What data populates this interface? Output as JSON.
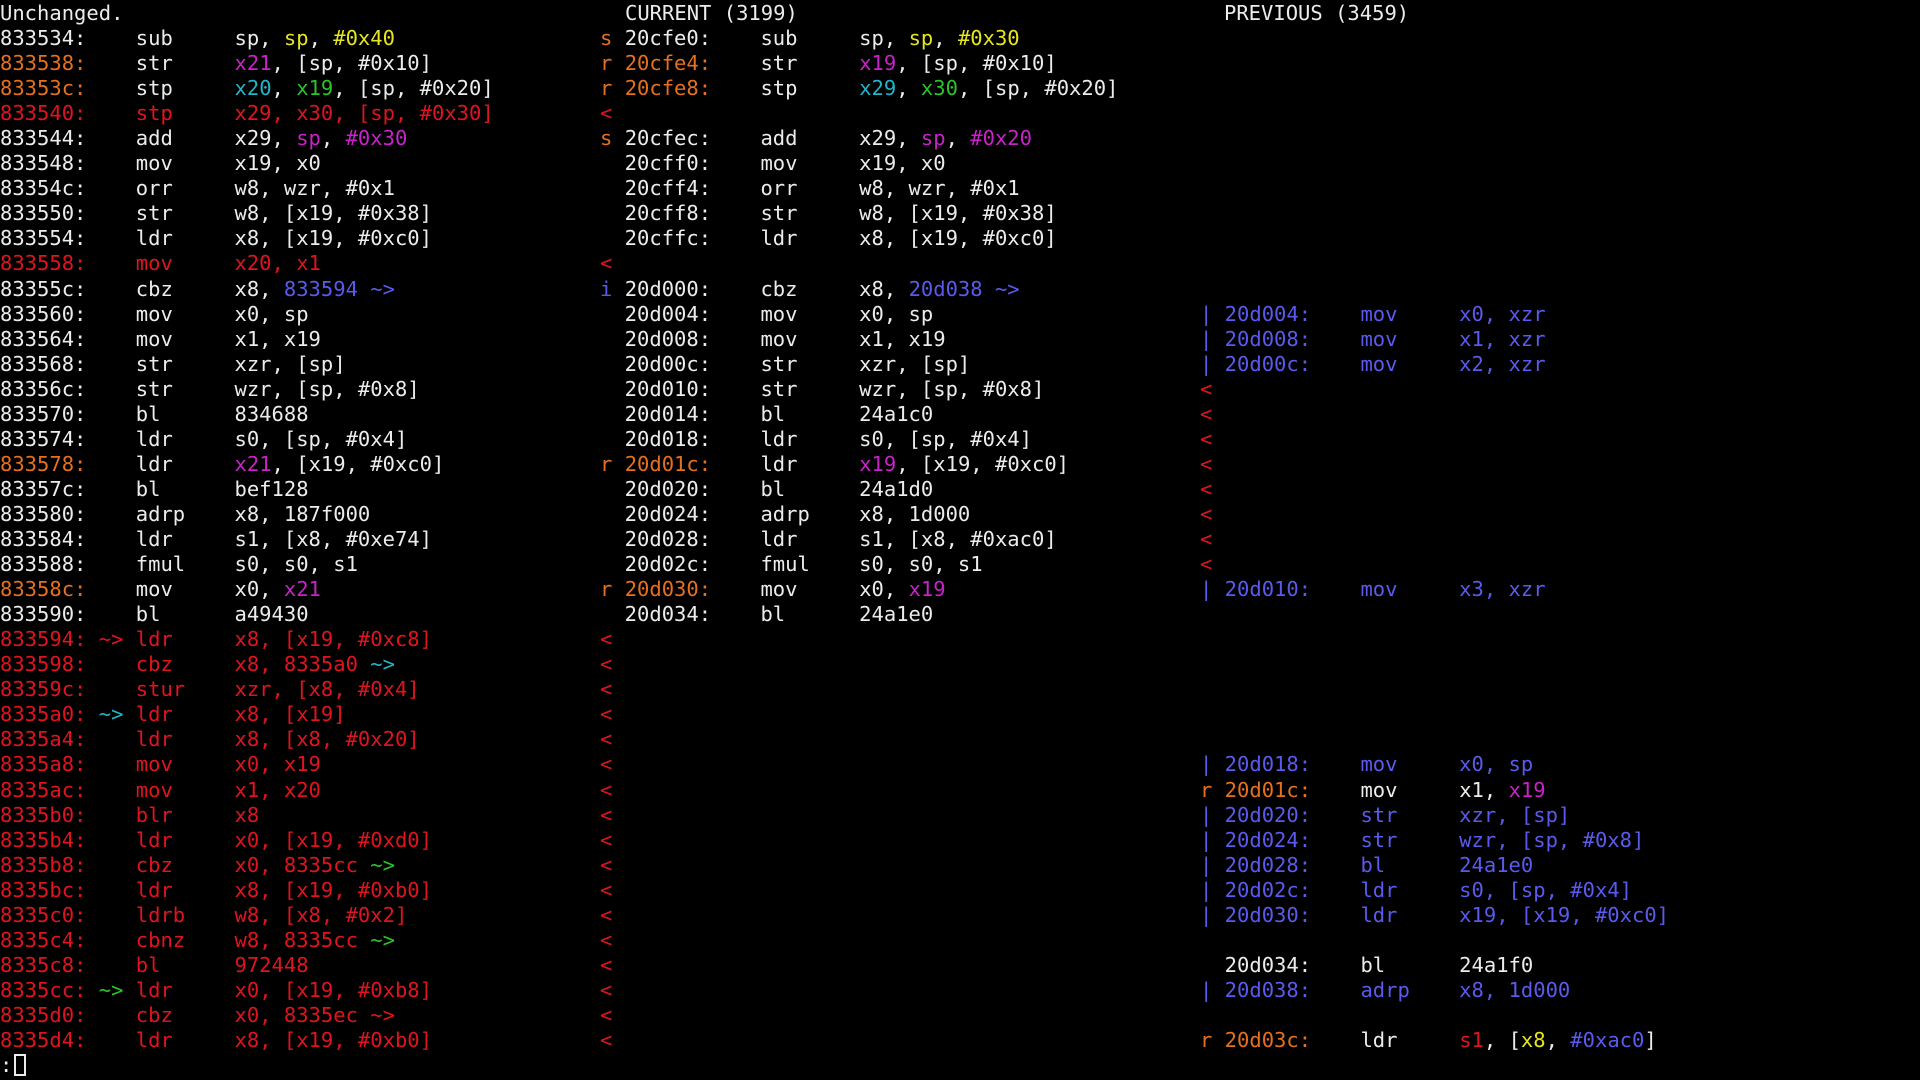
{
  "colors": {
    "default": "#ececec",
    "removed": "#e0141e",
    "changed": "#e6701e",
    "magenta": "#c823c8",
    "green": "#2bc42b",
    "cyan": "#20b6c8",
    "yellow": "#e6e61e",
    "blue": "#5a5aee"
  },
  "header": {
    "left_title": "Unchanged.",
    "current_title": "CURRENT (3199)",
    "previous_title": "PREVIOUS (3459)"
  },
  "prompt": ":",
  "rows": [
    [
      [
        [
          "default",
          "833534:    sub     sp, "
        ],
        [
          "yellow",
          "sp"
        ],
        [
          "default",
          ", "
        ],
        [
          "yellow",
          "#0x40"
        ]
      ],
      [
        [
          "changed",
          "s "
        ],
        [
          "default",
          "20cfe0:    sub     sp, "
        ],
        [
          "yellow",
          "sp"
        ],
        [
          "default",
          ", "
        ],
        [
          "yellow",
          "#0x30"
        ]
      ],
      []
    ],
    [
      [
        [
          "changed",
          "833538:    "
        ],
        [
          "default",
          "str     "
        ],
        [
          "magenta",
          "x21"
        ],
        [
          "default",
          ", [sp, #0x10]"
        ]
      ],
      [
        [
          "changed",
          "r "
        ],
        [
          "changed",
          "20cfe4:    "
        ],
        [
          "default",
          "str     "
        ],
        [
          "magenta",
          "x19"
        ],
        [
          "default",
          ", [sp, #0x10]"
        ]
      ],
      []
    ],
    [
      [
        [
          "changed",
          "83353c:    "
        ],
        [
          "default",
          "stp     "
        ],
        [
          "cyan",
          "x20"
        ],
        [
          "default",
          ", "
        ],
        [
          "green",
          "x19"
        ],
        [
          "default",
          ", [sp, #0x20]"
        ]
      ],
      [
        [
          "changed",
          "r "
        ],
        [
          "changed",
          "20cfe8:    "
        ],
        [
          "default",
          "stp     "
        ],
        [
          "cyan",
          "x29"
        ],
        [
          "default",
          ", "
        ],
        [
          "green",
          "x30"
        ],
        [
          "default",
          ", [sp, #0x20]"
        ]
      ],
      []
    ],
    [
      [
        [
          "removed",
          "833540:    stp     x29, x30, [sp, #0x30]"
        ]
      ],
      [
        [
          "removed",
          "<"
        ]
      ],
      []
    ],
    [
      [
        [
          "default",
          "833544:    add     x29, "
        ],
        [
          "magenta",
          "sp"
        ],
        [
          "default",
          ", "
        ],
        [
          "magenta",
          "#0x30"
        ]
      ],
      [
        [
          "changed",
          "s "
        ],
        [
          "default",
          "20cfec:    add     x29, "
        ],
        [
          "magenta",
          "sp"
        ],
        [
          "default",
          ", "
        ],
        [
          "magenta",
          "#0x20"
        ]
      ],
      []
    ],
    [
      [
        [
          "default",
          "833548:    mov     x19, x0"
        ]
      ],
      [
        [
          "default",
          "  20cff0:    mov     x19, x0"
        ]
      ],
      []
    ],
    [
      [
        [
          "default",
          "83354c:    orr     w8, wzr, #0x1"
        ]
      ],
      [
        [
          "default",
          "  20cff4:    orr     w8, wzr, #0x1"
        ]
      ],
      []
    ],
    [
      [
        [
          "default",
          "833550:    str     w8, [x19, #0x38]"
        ]
      ],
      [
        [
          "default",
          "  20cff8:    str     w8, [x19, #0x38]"
        ]
      ],
      []
    ],
    [
      [
        [
          "default",
          "833554:    ldr     x8, [x19, #0xc0]"
        ]
      ],
      [
        [
          "default",
          "  20cffc:    ldr     x8, [x19, #0xc0]"
        ]
      ],
      []
    ],
    [
      [
        [
          "removed",
          "833558:    mov     x20, x1"
        ]
      ],
      [
        [
          "removed",
          "<"
        ]
      ],
      []
    ],
    [
      [
        [
          "default",
          "83355c:    cbz     x8, "
        ],
        [
          "blue",
          "833594 ~>"
        ]
      ],
      [
        [
          "blue",
          "i "
        ],
        [
          "default",
          "20d000:    cbz     x8, "
        ],
        [
          "blue",
          "20d038 ~>"
        ]
      ],
      []
    ],
    [
      [
        [
          "default",
          "833560:    mov     x0, sp"
        ]
      ],
      [
        [
          "default",
          "  20d004:    mov     x0, sp"
        ]
      ],
      [
        [
          "blue",
          "| 20d004:    mov     x0, xzr"
        ]
      ]
    ],
    [
      [
        [
          "default",
          "833564:    mov     x1, x19"
        ]
      ],
      [
        [
          "default",
          "  20d008:    mov     x1, x19"
        ]
      ],
      [
        [
          "blue",
          "| 20d008:    mov     x1, xzr"
        ]
      ]
    ],
    [
      [
        [
          "default",
          "833568:    str     xzr, [sp]"
        ]
      ],
      [
        [
          "default",
          "  20d00c:    str     xzr, [sp]"
        ]
      ],
      [
        [
          "blue",
          "| 20d00c:    mov     x2, xzr"
        ]
      ]
    ],
    [
      [
        [
          "default",
          "83356c:    str     wzr, [sp, #0x8]"
        ]
      ],
      [
        [
          "default",
          "  20d010:    str     wzr, [sp, #0x8]"
        ]
      ],
      [
        [
          "removed",
          "<"
        ]
      ]
    ],
    [
      [
        [
          "default",
          "833570:    bl      834688"
        ]
      ],
      [
        [
          "default",
          "  20d014:    bl      24a1c0"
        ]
      ],
      [
        [
          "removed",
          "<"
        ]
      ]
    ],
    [
      [
        [
          "default",
          "833574:    ldr     s0, [sp, #0x4]"
        ]
      ],
      [
        [
          "default",
          "  20d018:    ldr     s0, [sp, #0x4]"
        ]
      ],
      [
        [
          "removed",
          "<"
        ]
      ]
    ],
    [
      [
        [
          "changed",
          "833578:    "
        ],
        [
          "default",
          "ldr     "
        ],
        [
          "magenta",
          "x21"
        ],
        [
          "default",
          ", [x19, #0xc0]"
        ]
      ],
      [
        [
          "changed",
          "r "
        ],
        [
          "changed",
          "20d01c:    "
        ],
        [
          "default",
          "ldr     "
        ],
        [
          "magenta",
          "x19"
        ],
        [
          "default",
          ", [x19, #0xc0]"
        ]
      ],
      [
        [
          "removed",
          "<"
        ]
      ]
    ],
    [
      [
        [
          "default",
          "83357c:    bl      bef128"
        ]
      ],
      [
        [
          "default",
          "  20d020:    bl      24a1d0"
        ]
      ],
      [
        [
          "removed",
          "<"
        ]
      ]
    ],
    [
      [
        [
          "default",
          "833580:    adrp    x8, 187f000"
        ]
      ],
      [
        [
          "default",
          "  20d024:    adrp    x8, 1d000"
        ]
      ],
      [
        [
          "removed",
          "<"
        ]
      ]
    ],
    [
      [
        [
          "default",
          "833584:    ldr     s1, [x8, #0xe74]"
        ]
      ],
      [
        [
          "default",
          "  20d028:    ldr     s1, [x8, #0xac0]"
        ]
      ],
      [
        [
          "removed",
          "<"
        ]
      ]
    ],
    [
      [
        [
          "default",
          "833588:    fmul    s0, s0, s1"
        ]
      ],
      [
        [
          "default",
          "  20d02c:    fmul    s0, s0, s1"
        ]
      ],
      [
        [
          "removed",
          "<"
        ]
      ]
    ],
    [
      [
        [
          "changed",
          "83358c:    "
        ],
        [
          "default",
          "mov     x0, "
        ],
        [
          "magenta",
          "x21"
        ]
      ],
      [
        [
          "changed",
          "r "
        ],
        [
          "changed",
          "20d030:    "
        ],
        [
          "default",
          "mov     x0, "
        ],
        [
          "magenta",
          "x19"
        ]
      ],
      [
        [
          "blue",
          "| 20d010:    mov     x3, xzr"
        ]
      ]
    ],
    [
      [
        [
          "default",
          "833590:    bl      a49430"
        ]
      ],
      [
        [
          "default",
          "  20d034:    bl      24a1e0"
        ]
      ],
      []
    ],
    [
      [
        [
          "removed",
          "833594: ~> ldr     x8, [x19, #0xc8]"
        ]
      ],
      [
        [
          "removed",
          "<"
        ]
      ],
      []
    ],
    [
      [
        [
          "removed",
          "833598:    cbz     x8, 8335a0 "
        ],
        [
          "cyan",
          "~>"
        ]
      ],
      [
        [
          "removed",
          "<"
        ]
      ],
      []
    ],
    [
      [
        [
          "removed",
          "83359c:    stur    xzr, [x8, #0x4]"
        ]
      ],
      [
        [
          "removed",
          "<"
        ]
      ],
      []
    ],
    [
      [
        [
          "removed",
          "8335a0: "
        ],
        [
          "cyan",
          "~>"
        ],
        [
          "removed",
          " ldr     x8, [x19]"
        ]
      ],
      [
        [
          "removed",
          "<"
        ]
      ],
      []
    ],
    [
      [
        [
          "removed",
          "8335a4:    ldr     x8, [x8, #0x20]"
        ]
      ],
      [
        [
          "removed",
          "<"
        ]
      ],
      []
    ],
    [
      [
        [
          "removed",
          "8335a8:    mov     x0, x19"
        ]
      ],
      [
        [
          "removed",
          "<"
        ]
      ],
      [
        [
          "blue",
          "| 20d018:    mov     x0, sp"
        ]
      ]
    ],
    [
      [
        [
          "removed",
          "8335ac:    mov     x1, x20"
        ]
      ],
      [
        [
          "removed",
          "<"
        ]
      ],
      [
        [
          "changed",
          "r 20d01c:    "
        ],
        [
          "default",
          "mov     x1, "
        ],
        [
          "magenta",
          "x19"
        ]
      ]
    ],
    [
      [
        [
          "removed",
          "8335b0:    blr     x8"
        ]
      ],
      [
        [
          "removed",
          "<"
        ]
      ],
      [
        [
          "blue",
          "| 20d020:    str     xzr, [sp]"
        ]
      ]
    ],
    [
      [
        [
          "removed",
          "8335b4:    ldr     x0, [x19, #0xd0]"
        ]
      ],
      [
        [
          "removed",
          "<"
        ]
      ],
      [
        [
          "blue",
          "| 20d024:    str     wzr, [sp, #0x8]"
        ]
      ]
    ],
    [
      [
        [
          "removed",
          "8335b8:    cbz     x0, 8335cc "
        ],
        [
          "green",
          "~>"
        ]
      ],
      [
        [
          "removed",
          "<"
        ]
      ],
      [
        [
          "blue",
          "| 20d028:    bl      24a1e0"
        ]
      ]
    ],
    [
      [
        [
          "removed",
          "8335bc:    ldr     x8, [x19, #0xb0]"
        ]
      ],
      [
        [
          "removed",
          "<"
        ]
      ],
      [
        [
          "blue",
          "| 20d02c:    ldr     s0, [sp, #0x4]"
        ]
      ]
    ],
    [
      [
        [
          "removed",
          "8335c0:    ldrb    w8, [x8, #0x2]"
        ]
      ],
      [
        [
          "removed",
          "<"
        ]
      ],
      [
        [
          "blue",
          "| 20d030:    ldr     x19, [x19, #0xc0]"
        ]
      ]
    ],
    [
      [
        [
          "removed",
          "8335c4:    cbnz    w8, 8335cc "
        ],
        [
          "green",
          "~>"
        ]
      ],
      [
        [
          "removed",
          "<"
        ]
      ],
      []
    ],
    [
      [
        [
          "removed",
          "8335c8:    bl      972448"
        ]
      ],
      [
        [
          "removed",
          "<"
        ]
      ],
      [
        [
          "default",
          "  20d034:    bl      24a1f0"
        ]
      ]
    ],
    [
      [
        [
          "removed",
          "8335cc: "
        ],
        [
          "green",
          "~>"
        ],
        [
          "removed",
          " ldr     x0, [x19, #0xb8]"
        ]
      ],
      [
        [
          "removed",
          "<"
        ]
      ],
      [
        [
          "blue",
          "| 20d038:    adrp    x8, 1d000"
        ]
      ]
    ],
    [
      [
        [
          "removed",
          "8335d0:    cbz     x0, 8335ec ~>"
        ]
      ],
      [
        [
          "removed",
          "<"
        ]
      ],
      []
    ],
    [
      [
        [
          "removed",
          "8335d4:    ldr     x8, [x19, #0xb0]"
        ]
      ],
      [
        [
          "removed",
          "<"
        ]
      ],
      [
        [
          "changed",
          "r 20d03c:    "
        ],
        [
          "default",
          "ldr     "
        ],
        [
          "removed",
          "s1"
        ],
        [
          "default",
          ", ["
        ],
        [
          "yellow",
          "x8"
        ],
        [
          "default",
          ", "
        ],
        [
          "blue",
          "#0xac0"
        ],
        [
          "default",
          "]"
        ]
      ]
    ]
  ]
}
